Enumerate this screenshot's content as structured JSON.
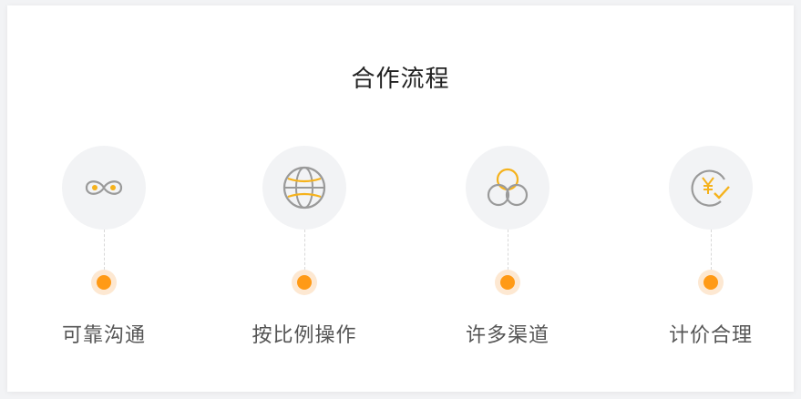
{
  "section": {
    "title": "合作流程"
  },
  "steps": [
    {
      "label": "可靠沟通",
      "icon": "link-icon"
    },
    {
      "label": "按比例操作",
      "icon": "globe-icon"
    },
    {
      "label": "许多渠道",
      "icon": "channels-icon"
    },
    {
      "label": "计价合理",
      "icon": "price-check-icon"
    }
  ],
  "colors": {
    "accent": "#ff9a16",
    "accent_halo": "#fde8d2",
    "icon_gray": "#9a9a9a",
    "icon_gold": "#f5b21c",
    "circle_bg": "#f2f3f5"
  }
}
